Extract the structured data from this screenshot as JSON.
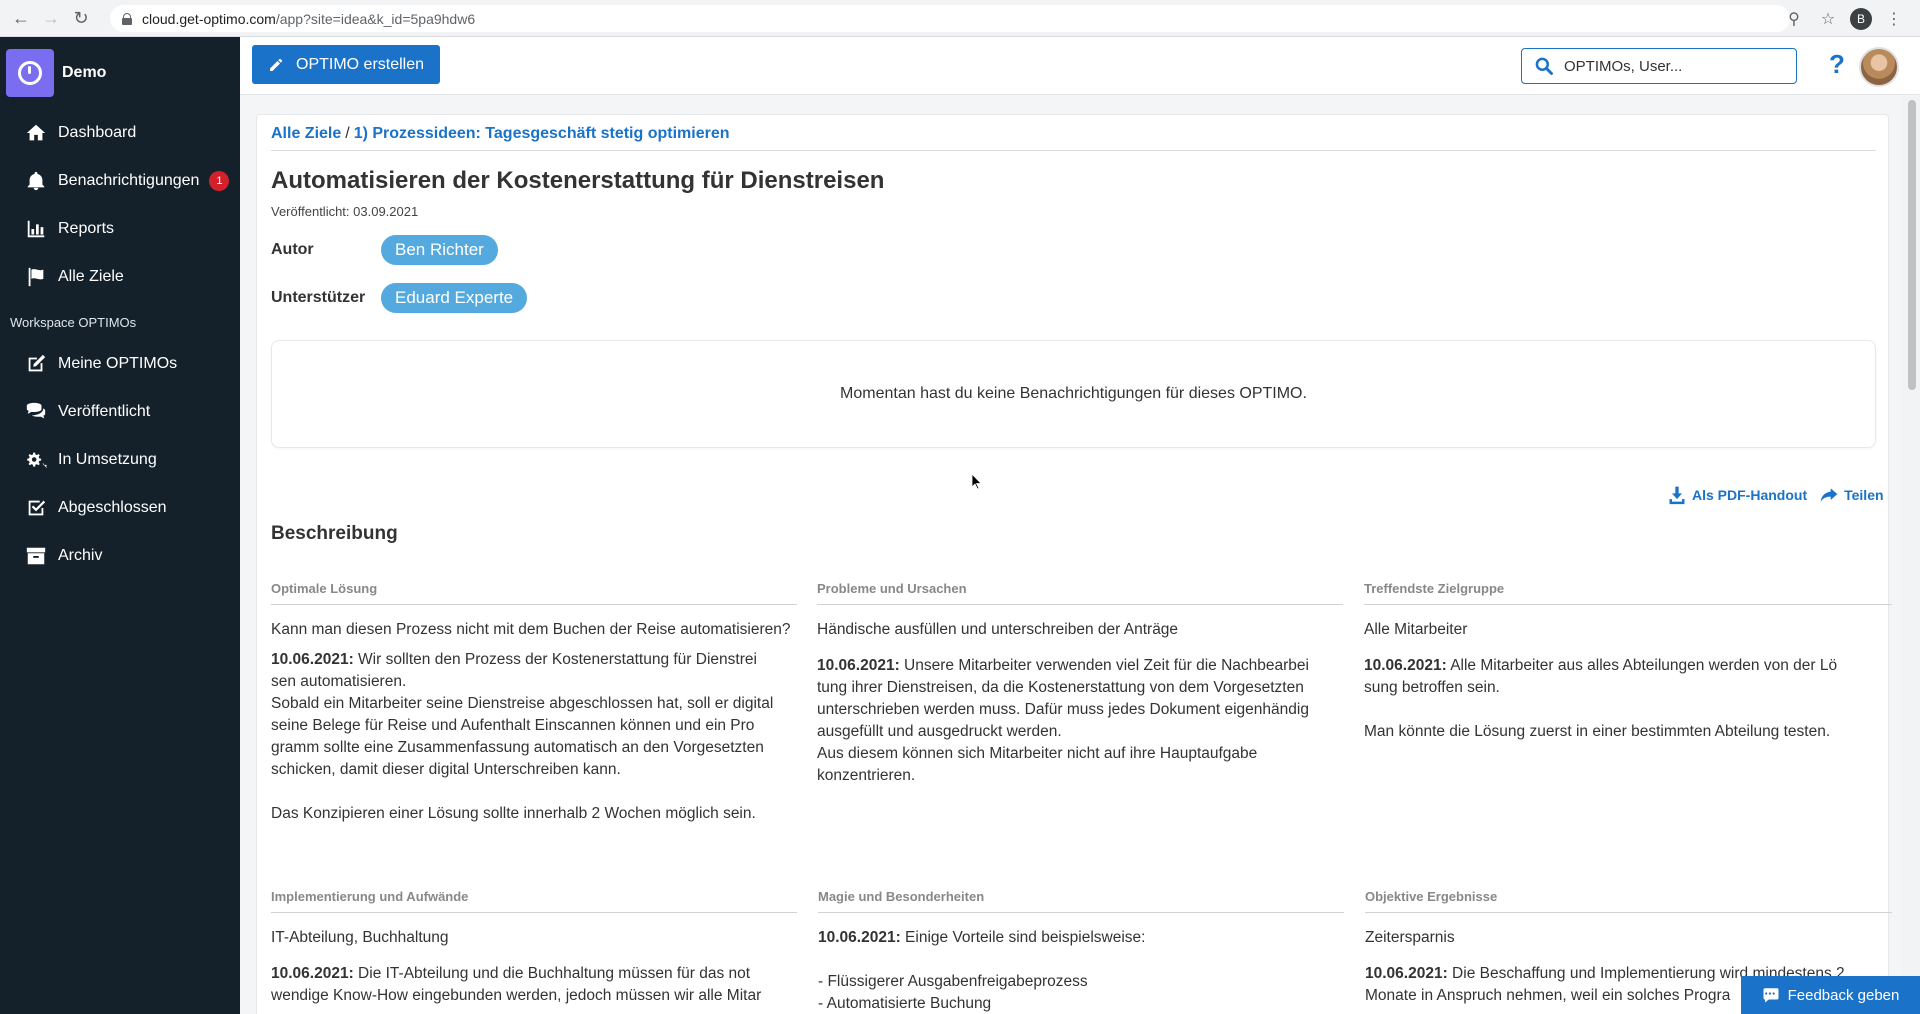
{
  "browser": {
    "url_host": "cloud.get-optimo.com",
    "url_path": "/app?site=idea&k_id=5pa9hdw6",
    "profile_initial": "B"
  },
  "brand": {
    "name": "Demo"
  },
  "sidebar": {
    "items": [
      {
        "label": "Dashboard",
        "icon": "home-icon"
      },
      {
        "label": "Benachrichtigungen",
        "icon": "bell-icon",
        "badge": "1"
      },
      {
        "label": "Reports",
        "icon": "bar-chart-icon"
      },
      {
        "label": "Alle Ziele",
        "icon": "flag-icon"
      }
    ],
    "section_title": "Workspace OPTIMOs",
    "workspace_items": [
      {
        "label": "Meine OPTIMOs",
        "icon": "edit-icon"
      },
      {
        "label": "Veröffentlicht",
        "icon": "comments-icon"
      },
      {
        "label": "In Umsetzung",
        "icon": "gears-icon"
      },
      {
        "label": "Abgeschlossen",
        "icon": "check-square-icon"
      },
      {
        "label": "Archiv",
        "icon": "archive-icon"
      }
    ]
  },
  "topbar": {
    "create_label": "OPTIMO erstellen",
    "search_placeholder": "OPTIMOs, User...",
    "help": "?"
  },
  "breadcrumb": {
    "root": "Alle Ziele",
    "sep": "/",
    "current": "1) Prozessideen: Tagesgeschäft stetig optimieren"
  },
  "optimo": {
    "title": "Automatisieren der Kostenerstattung für Dienstreisen",
    "published": "Veröffentlicht: 03.09.2021",
    "author_label": "Autor",
    "author": "Ben Richter",
    "supporter_label": "Unterstützer",
    "supporter": "Eduard Experte",
    "notice": "Momentan hast du keine Benachrichtigungen für dieses OPTIMO.",
    "pdf_label": "Als PDF-Handout",
    "share_label": "Teilen",
    "section_title": "Beschreibung"
  },
  "fields": [
    {
      "label": "Optimale Lösung",
      "summary": "Kann man diesen Prozess nicht mit dem Buchen der Reise automatisieren?",
      "date": "10.06.2021:",
      "text": " Wir sollten den Prozess der Kostenerstattung für Dienstrei­\nsen automatisieren.\nSobald ein Mitarbeiter seine Dienstreise abgeschlossen hat, soll er digital seine Belege für Reise und Aufenthalt Einscannen können und ein Pro­\ngramm sollte eine Zusammenfassung automatisch an den Vorgesetzten schicken, damit dieser digital Unterschreiben kann.\n\nDas Konzipieren einer Lösung sollte innerhalb 2 Wochen möglich sein."
    },
    {
      "label": "Probleme und Ursachen",
      "summary": "Händische ausfüllen und unterschreiben der Anträge",
      "date": "10.06.2021:",
      "text": " Unsere Mitarbeiter verwenden viel Zeit für die Nachbearbei­\ntung ihrer Dienstreisen, da die Kostenerstattung von dem Vorgesetzten unterschrieben werden muss. Dafür muss jedes Dokument eigenhändig ausgefüllt und ausgedruckt werden.\nAus diesem können sich Mitarbeiter nicht auf ihre Hauptaufgabe konzentrieren."
    },
    {
      "label": "Treffendste Zielgruppe",
      "summary": "Alle Mitarbeiter",
      "date": "10.06.2021:",
      "text": " Alle Mitarbeiter aus alles Abteilungen werden von der Lö­\nsung betroffen sein.\n\nMan könnte die Lösung zuerst in einer bestimmten Abteilung testen."
    },
    {
      "label": "Implementierung und Aufwände",
      "summary": "IT-Abteilung, Buchhaltung",
      "date": "10.06.2021:",
      "text": " Die IT-Abteilung und die Buchhaltung müssen für das not­\nwendige Know-How eingebunden werden, jedoch müssen wir alle Mitar­"
    },
    {
      "label": "Magie und Besonderheiten",
      "summary": "",
      "date": "10.06.2021:",
      "text": " Einige Vorteile sind beispielsweise:\n\n- Flüssigerer Ausgabenfreigabeprozess\n- Automatisierte Buchung"
    },
    {
      "label": "Objektive Ergebnisse",
      "summary": "Zeitersparnis",
      "date": "10.06.2021:",
      "text": " Die Beschaffung und Implementierung wird mindestens 2 Monate in Anspruch nehmen, weil ein solches Progra"
    }
  ],
  "feedback_label": "Feedback geben",
  "colors": {
    "primary": "#1a73c8",
    "sidebar": "#14212b",
    "pill": "#54a9de",
    "badge": "#d3202a"
  }
}
